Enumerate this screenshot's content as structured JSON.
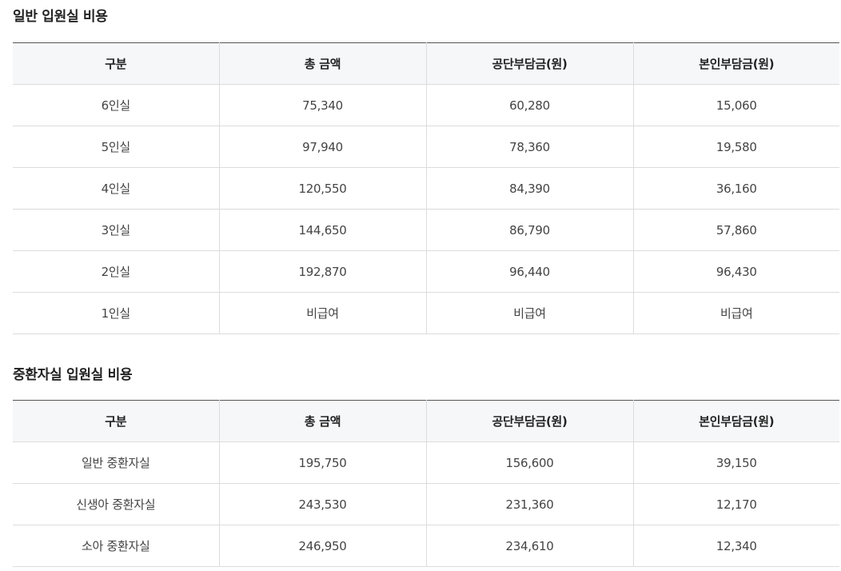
{
  "sections": [
    {
      "title": "일반 입원실 비용",
      "headers": [
        "구분",
        "총 금액",
        "공단부담금(원)",
        "본인부담금(원)"
      ],
      "rows": [
        [
          "6인실",
          "75,340",
          "60,280",
          "15,060"
        ],
        [
          "5인실",
          "97,940",
          "78,360",
          "19,580"
        ],
        [
          "4인실",
          "120,550",
          "84,390",
          "36,160"
        ],
        [
          "3인실",
          "144,650",
          "86,790",
          "57,860"
        ],
        [
          "2인실",
          "192,870",
          "96,440",
          "96,430"
        ],
        [
          "1인실",
          "비급여",
          "비급여",
          "비급여"
        ]
      ]
    },
    {
      "title": "중환자실 입원실 비용",
      "headers": [
        "구분",
        "총 금액",
        "공단부담금(원)",
        "본인부담금(원)"
      ],
      "rows": [
        [
          "일반 중환자실",
          "195,750",
          "156,600",
          "39,150"
        ],
        [
          "신생아 중환자실",
          "243,530",
          "231,360",
          "12,170"
        ],
        [
          "소아 중환자실",
          "246,950",
          "234,610",
          "12,340"
        ]
      ]
    }
  ]
}
